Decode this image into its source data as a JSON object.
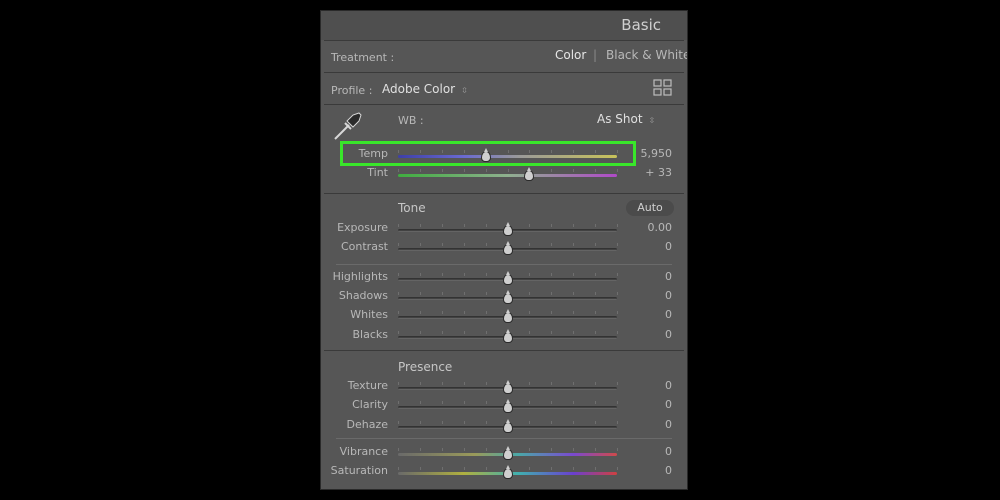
{
  "panel": {
    "title": "Basic"
  },
  "treatment": {
    "label": "Treatment :",
    "color": "Color",
    "separator": "|",
    "bw": "Black & White",
    "selected": "Color"
  },
  "profile": {
    "label": "Profile :",
    "value": "Adobe Color",
    "arrow": "⇳"
  },
  "wb": {
    "label": "WB :",
    "value": "As Shot",
    "arrow": "⇳"
  },
  "sliders": {
    "temp": {
      "label": "Temp",
      "value": "5,950",
      "level": 0.4
    },
    "tint": {
      "label": "Tint",
      "value": "+ 33",
      "level": 0.6
    },
    "exposure": {
      "label": "Exposure",
      "value": "0.00",
      "level": 0.5
    },
    "contrast": {
      "label": "Contrast",
      "value": "0",
      "level": 0.5
    },
    "highlights": {
      "label": "Highlights",
      "value": "0",
      "level": 0.5
    },
    "shadows": {
      "label": "Shadows",
      "value": "0",
      "level": 0.5
    },
    "whites": {
      "label": "Whites",
      "value": "0",
      "level": 0.5
    },
    "blacks": {
      "label": "Blacks",
      "value": "0",
      "level": 0.5
    },
    "texture": {
      "label": "Texture",
      "value": "0",
      "level": 0.5
    },
    "clarity": {
      "label": "Clarity",
      "value": "0",
      "level": 0.5
    },
    "dehaze": {
      "label": "Dehaze",
      "value": "0",
      "level": 0.5
    },
    "vibrance": {
      "label": "Vibrance",
      "value": "0",
      "level": 0.5
    },
    "saturation": {
      "label": "Saturation",
      "value": "0",
      "level": 0.5
    }
  },
  "tone": {
    "title": "Tone",
    "auto": "Auto"
  },
  "presence": {
    "title": "Presence"
  },
  "colors": {
    "highlight": "#39e62a",
    "panel_bg": "#565656"
  },
  "icons": {
    "eyedropper": "eyedropper-icon",
    "grid": "profile-grid-icon"
  }
}
